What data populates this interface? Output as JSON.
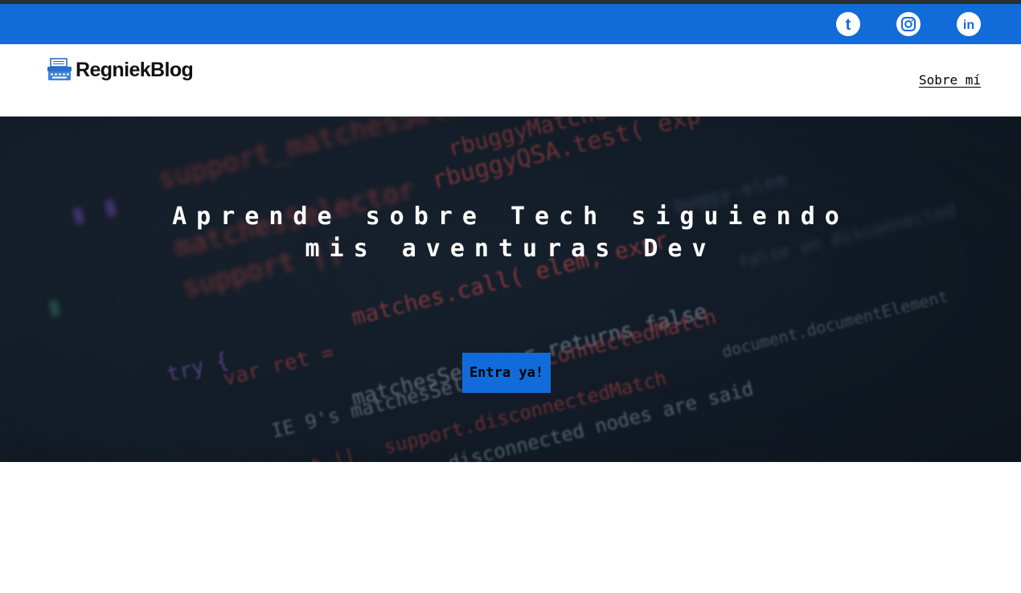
{
  "social": {
    "icons": [
      "tumblr-icon",
      "instagram-icon",
      "linkedin-icon"
    ],
    "tumblr_glyph": "t",
    "linkedin_glyph": "in"
  },
  "header": {
    "logo_text": "RegniekBlog",
    "logo_icon": "typewriter-icon",
    "nav_about": "Sobre mí"
  },
  "hero": {
    "title_line1": "Aprende sobre Tech siguiendo",
    "title_line2": "mis aventuras Dev",
    "cta_label": "Entra ya!"
  },
  "colors": {
    "brand_blue": "#116bd9",
    "hero_bg": "#1a2532",
    "white": "#ffffff"
  }
}
